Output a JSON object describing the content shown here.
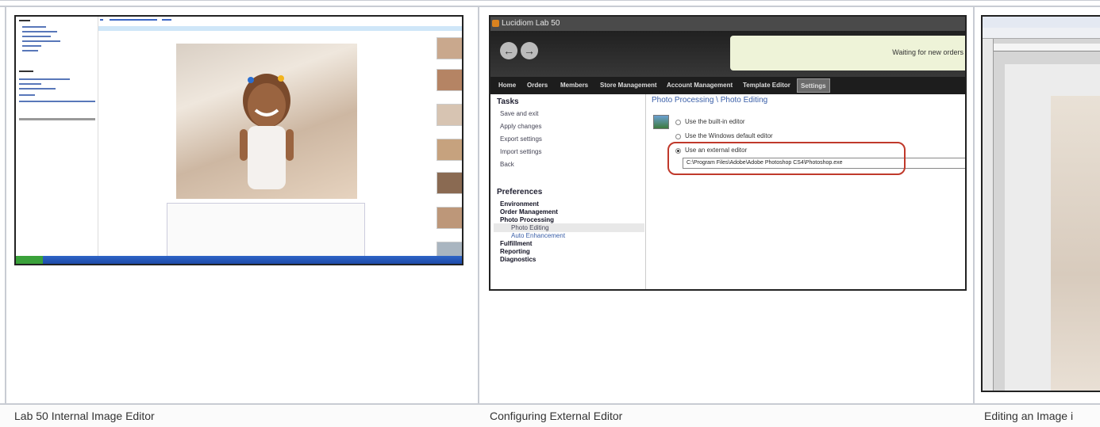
{
  "gallery": {
    "items": [
      {
        "caption": "Lab 50 Internal Image Editor"
      },
      {
        "caption": "Configuring External Editor"
      },
      {
        "caption": "Editing an Image i"
      }
    ]
  },
  "settings_screenshot": {
    "window_title": "Lucidiom Lab 50",
    "banner": "Waiting for new orders",
    "nav": [
      "Home",
      "Orders",
      "Members",
      "Store Management",
      "Account Management",
      "Template Editor",
      "Settings"
    ],
    "tasks_heading": "Tasks",
    "tasks": [
      "Save and exit",
      "Apply changes",
      "Export settings",
      "Import settings",
      "Back"
    ],
    "preferences_heading": "Preferences",
    "preferences": [
      "Environment",
      "Order Management",
      "Photo Processing",
      "Photo Editing",
      "Auto Enhancement",
      "Fulfillment",
      "Reporting",
      "Diagnostics"
    ],
    "section_title": "Photo Processing \\ Photo Editing",
    "options": [
      "Use the built-in editor",
      "Use the Windows default editor",
      "Use an external editor"
    ],
    "editor_path": "C:\\Program Files\\Adobe\\Adobe Photoshop CS4\\Photoshop.exe"
  },
  "colors": {
    "accent": "#3a5fa8",
    "highlight": "#c0392b",
    "border": "#c8ccd3"
  }
}
